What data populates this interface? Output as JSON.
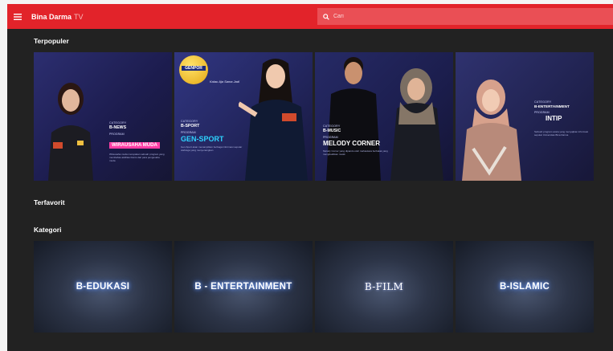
{
  "header": {
    "brand_name": "Bina Darma",
    "brand_suffix": "TV",
    "search_placeholder": "Cari",
    "accent": "#e2232a"
  },
  "sections": {
    "popular_title": "Terpopuler",
    "favorite_title": "Terfavorit",
    "category_title": "Kategori"
  },
  "popular": [
    {
      "category_label": "CATEGORY",
      "category": "B-NEWS",
      "program_label": "PROGRAM",
      "program": "WIRAUSAHA MUDA",
      "description": "Wirausaha muda merupakan sebuah program yang membahas aktifitas bisnis dari para pengusaha muda"
    },
    {
      "logo_text": "GENPOR",
      "tagline": "Kalau Aja Sama Jadi",
      "category_label": "CATEGORY",
      "category": "B-SPORT",
      "program_label": "PROGRAM",
      "program": "GEN-SPORT",
      "description": "Gen-Sport akan menampilkan berbagai informasi seputar olahraga yang menyenangkan"
    },
    {
      "category_label": "CATEGORY",
      "category": "B-MUSIC",
      "program_label": "PROGRAM",
      "program": "MELODY CORNER",
      "description": "Melody Corner yang dipandu oleh mahasiswa berbakat yang menghadirkan musik"
    },
    {
      "category_label": "CATEGORY",
      "category": "B-ENTERTAINMENT",
      "program_label": "PROGRAM",
      "program": "INTIP",
      "description": "Sebuah program acara yang menyajikan informasi seputar Universitas Bina Darma"
    }
  ],
  "categories": [
    {
      "label": "B-EDUKASI"
    },
    {
      "label": "B - ENTERTAINMENT"
    },
    {
      "label": "B-FILM"
    },
    {
      "label": "B-ISLAMIC"
    }
  ]
}
